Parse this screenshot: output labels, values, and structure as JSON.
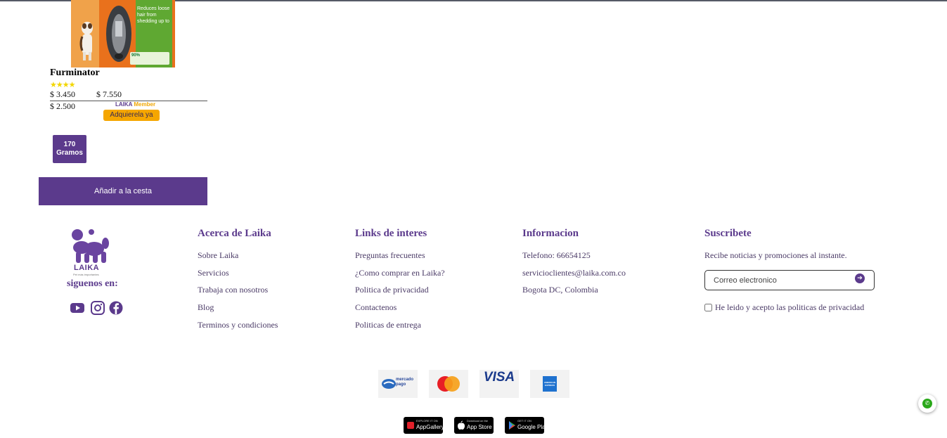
{
  "product": {
    "name": "Furminator",
    "rating_stars": "★★★★",
    "rating": 4,
    "price_primary": "$ 3.450",
    "price_secondary": "$ 7.550",
    "price_member": "$ 2.500",
    "member_brand": "LAIKA",
    "member_label": "Member",
    "acquire_label": "Adquierela ya",
    "weight_value": "170",
    "weight_unit": "Gramos",
    "add_to_cart_label": "Añadir a la cesta",
    "image_text": {
      "claim": "Reduces loose hair from shedding up to",
      "percent": "90%"
    }
  },
  "footer": {
    "logo_text": "LAIKA",
    "logo_tagline": "Pet más importantes",
    "follow_label": "siguenos en:",
    "social": [
      "youtube-icon",
      "instagram-icon",
      "facebook-icon"
    ],
    "about": {
      "title": "Acerca de Laika",
      "links": [
        "Sobre Laika",
        "Servicios",
        "Trabaja con nosotros",
        "Blog",
        "Terminos y condiciones"
      ]
    },
    "interest": {
      "title": "Links de interes",
      "links": [
        "Preguntas frecuentes",
        "¿Como comprar en Laika?",
        "Politica de privacidad",
        "Contactenos",
        "Politicas de entrega"
      ]
    },
    "info": {
      "title": "Informacion",
      "phone": "Telefono: 66654125",
      "email": "servicioclientes@laika.com.co",
      "location": "Bogota DC, Colombia"
    },
    "subscribe": {
      "title": "Suscribete",
      "text": "Recibe noticias y promociones al instante.",
      "email_placeholder": "Correo electronico",
      "email_value": "",
      "privacy_label": "He leido y acepto las politicas de privacidad"
    },
    "payments": {
      "mercadopago_line1": "mercado",
      "mercadopago_line2": "pago",
      "visa": "VISA",
      "amex": "AMERICAN EXPRESS"
    },
    "stores": {
      "huawei_small": "EXPLORE IT ON",
      "huawei_big": "AppGallery",
      "apple_small": "Download on the",
      "apple_big": "App Store",
      "google_small": "GET IT ON",
      "google_big": "Google Play"
    }
  },
  "colors": {
    "brand_purple": "#5b3a8c",
    "accent_orange": "#f5a600",
    "star_yellow": "#f2d600",
    "whatsapp_green": "#2aa81a"
  }
}
